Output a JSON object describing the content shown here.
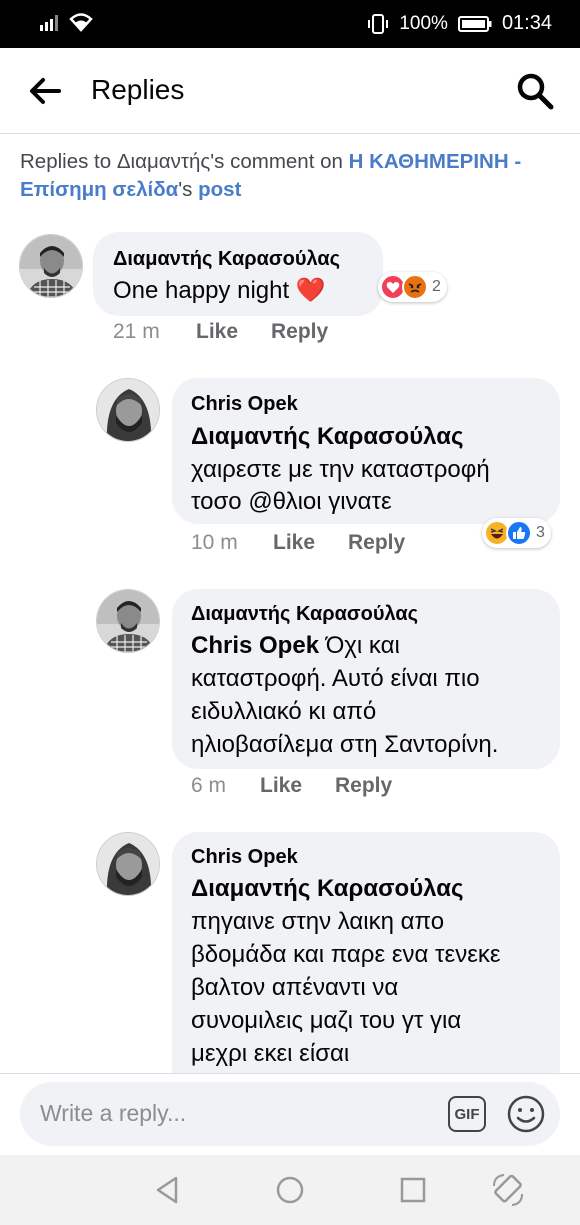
{
  "status": {
    "battery": "100%",
    "time": "01:34"
  },
  "header": {
    "title": "Replies"
  },
  "context": {
    "prefix": "Replies to Διαμαντής's comment on ",
    "page_name": "Η ΚΑΘΗΜΕΡΙΝΗ - Επίσημη σελίδα",
    "middle": "'s ",
    "post": "post"
  },
  "comments": [
    {
      "author": "Διαμαντής Καρασούλας",
      "text": "One happy night ❤️",
      "ago": "21 m",
      "like": "Like",
      "reply": "Reply",
      "reaction_count": "2",
      "reactions": [
        "love",
        "angry"
      ]
    },
    {
      "author": "Chris Opek",
      "mention": "Διαμαντής Καρασούλας",
      "lines": [
        "χαιρεστε με την καταστροφή",
        "τοσο @θλιοι γινατε"
      ],
      "ago": "10 m",
      "like": "Like",
      "reply": "Reply",
      "reaction_count": "3",
      "reactions": [
        "haha",
        "like"
      ]
    },
    {
      "author": "Διαμαντής Καρασούλας",
      "mention": "Chris Opek",
      "lines": [
        " Όχι και",
        "καταστροφή. Αυτό είναι πιο",
        "ειδυλλιακό κι από",
        "ηλιοβασίλεμα στη Σαντορίνη."
      ],
      "ago": "6 m",
      "like": "Like",
      "reply": "Reply"
    },
    {
      "author": "Chris Opek",
      "mention": "Διαμαντής Καρασούλας",
      "lines": [
        "πηγαινε στην λαικη απο",
        "βδομάδα και παρε ενα τενεκε",
        "βαλτον απέναντι να",
        "συνομιλεις μαζι του γτ για",
        "μεχρι εκει είσαι"
      ]
    }
  ],
  "composer": {
    "placeholder": "Write a reply...",
    "gif_label": "GIF"
  },
  "colors": {
    "link": "#4a7cc9",
    "bubble": "#f0f2f5",
    "heart": "#e0245e",
    "like": "#1877f2"
  },
  "icons": [
    "back-arrow-icon",
    "search-icon",
    "wifi-icon",
    "signal-icon",
    "battery-icon",
    "gif-icon",
    "smiley-icon",
    "nav-back-icon",
    "nav-home-icon",
    "nav-recents-icon",
    "rotate-icon"
  ]
}
